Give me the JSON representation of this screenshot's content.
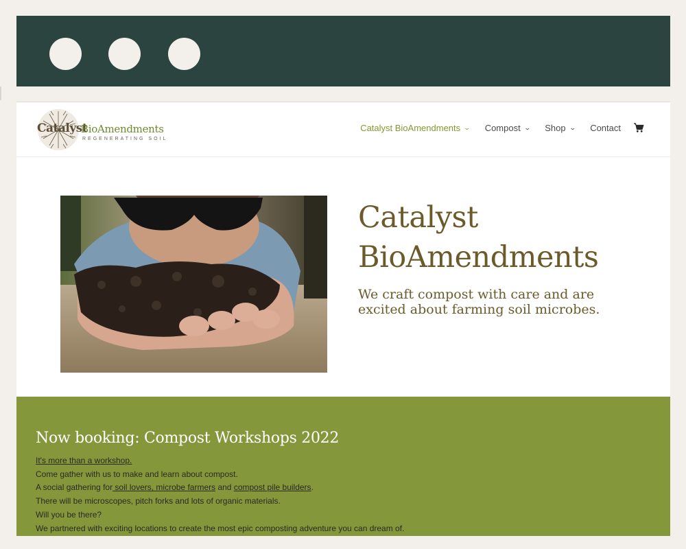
{
  "header": {
    "logo": {
      "word1": "Catalyst",
      "word2": "BioAmendments",
      "tagline": "REGENERATING SOIL"
    },
    "nav": [
      {
        "label": "Catalyst BioAmendments",
        "active": true,
        "dropdown": true
      },
      {
        "label": "Compost",
        "active": false,
        "dropdown": true
      },
      {
        "label": "Shop",
        "active": false,
        "dropdown": true
      },
      {
        "label": "Contact",
        "active": false,
        "dropdown": false
      }
    ],
    "cart_icon": "cart-icon"
  },
  "hero": {
    "title_line1": "Catalyst",
    "title_line2": "BioAmendments",
    "subtitle_line1": "We craft compost with care and are",
    "subtitle_line2": "excited about farming soil microbes."
  },
  "workshops": {
    "title": "Now booking: Compost Workshops 2022",
    "link_more": "It's more than a workshop.",
    "line2": "Come gather with us to make and learn about compost.",
    "line3_prefix": "A social gathering for",
    "line3_link1": " soil lovers, microbe farmers",
    "line3_mid": " and ",
    "line3_link2": "compost pile builders",
    "line3_suffix": ".",
    "line4": "There will be microscopes, pitch forks and lots of organic materials.",
    "line5": "Will you be there?",
    "line6": "We partnered with exciting locations to create the most epic composting adventure you can dream of."
  },
  "colors": {
    "chrome": "#2b4440",
    "accent_green": "#84973a",
    "nav_active": "#7e9a2f",
    "title_brown": "#6b5a2a"
  }
}
